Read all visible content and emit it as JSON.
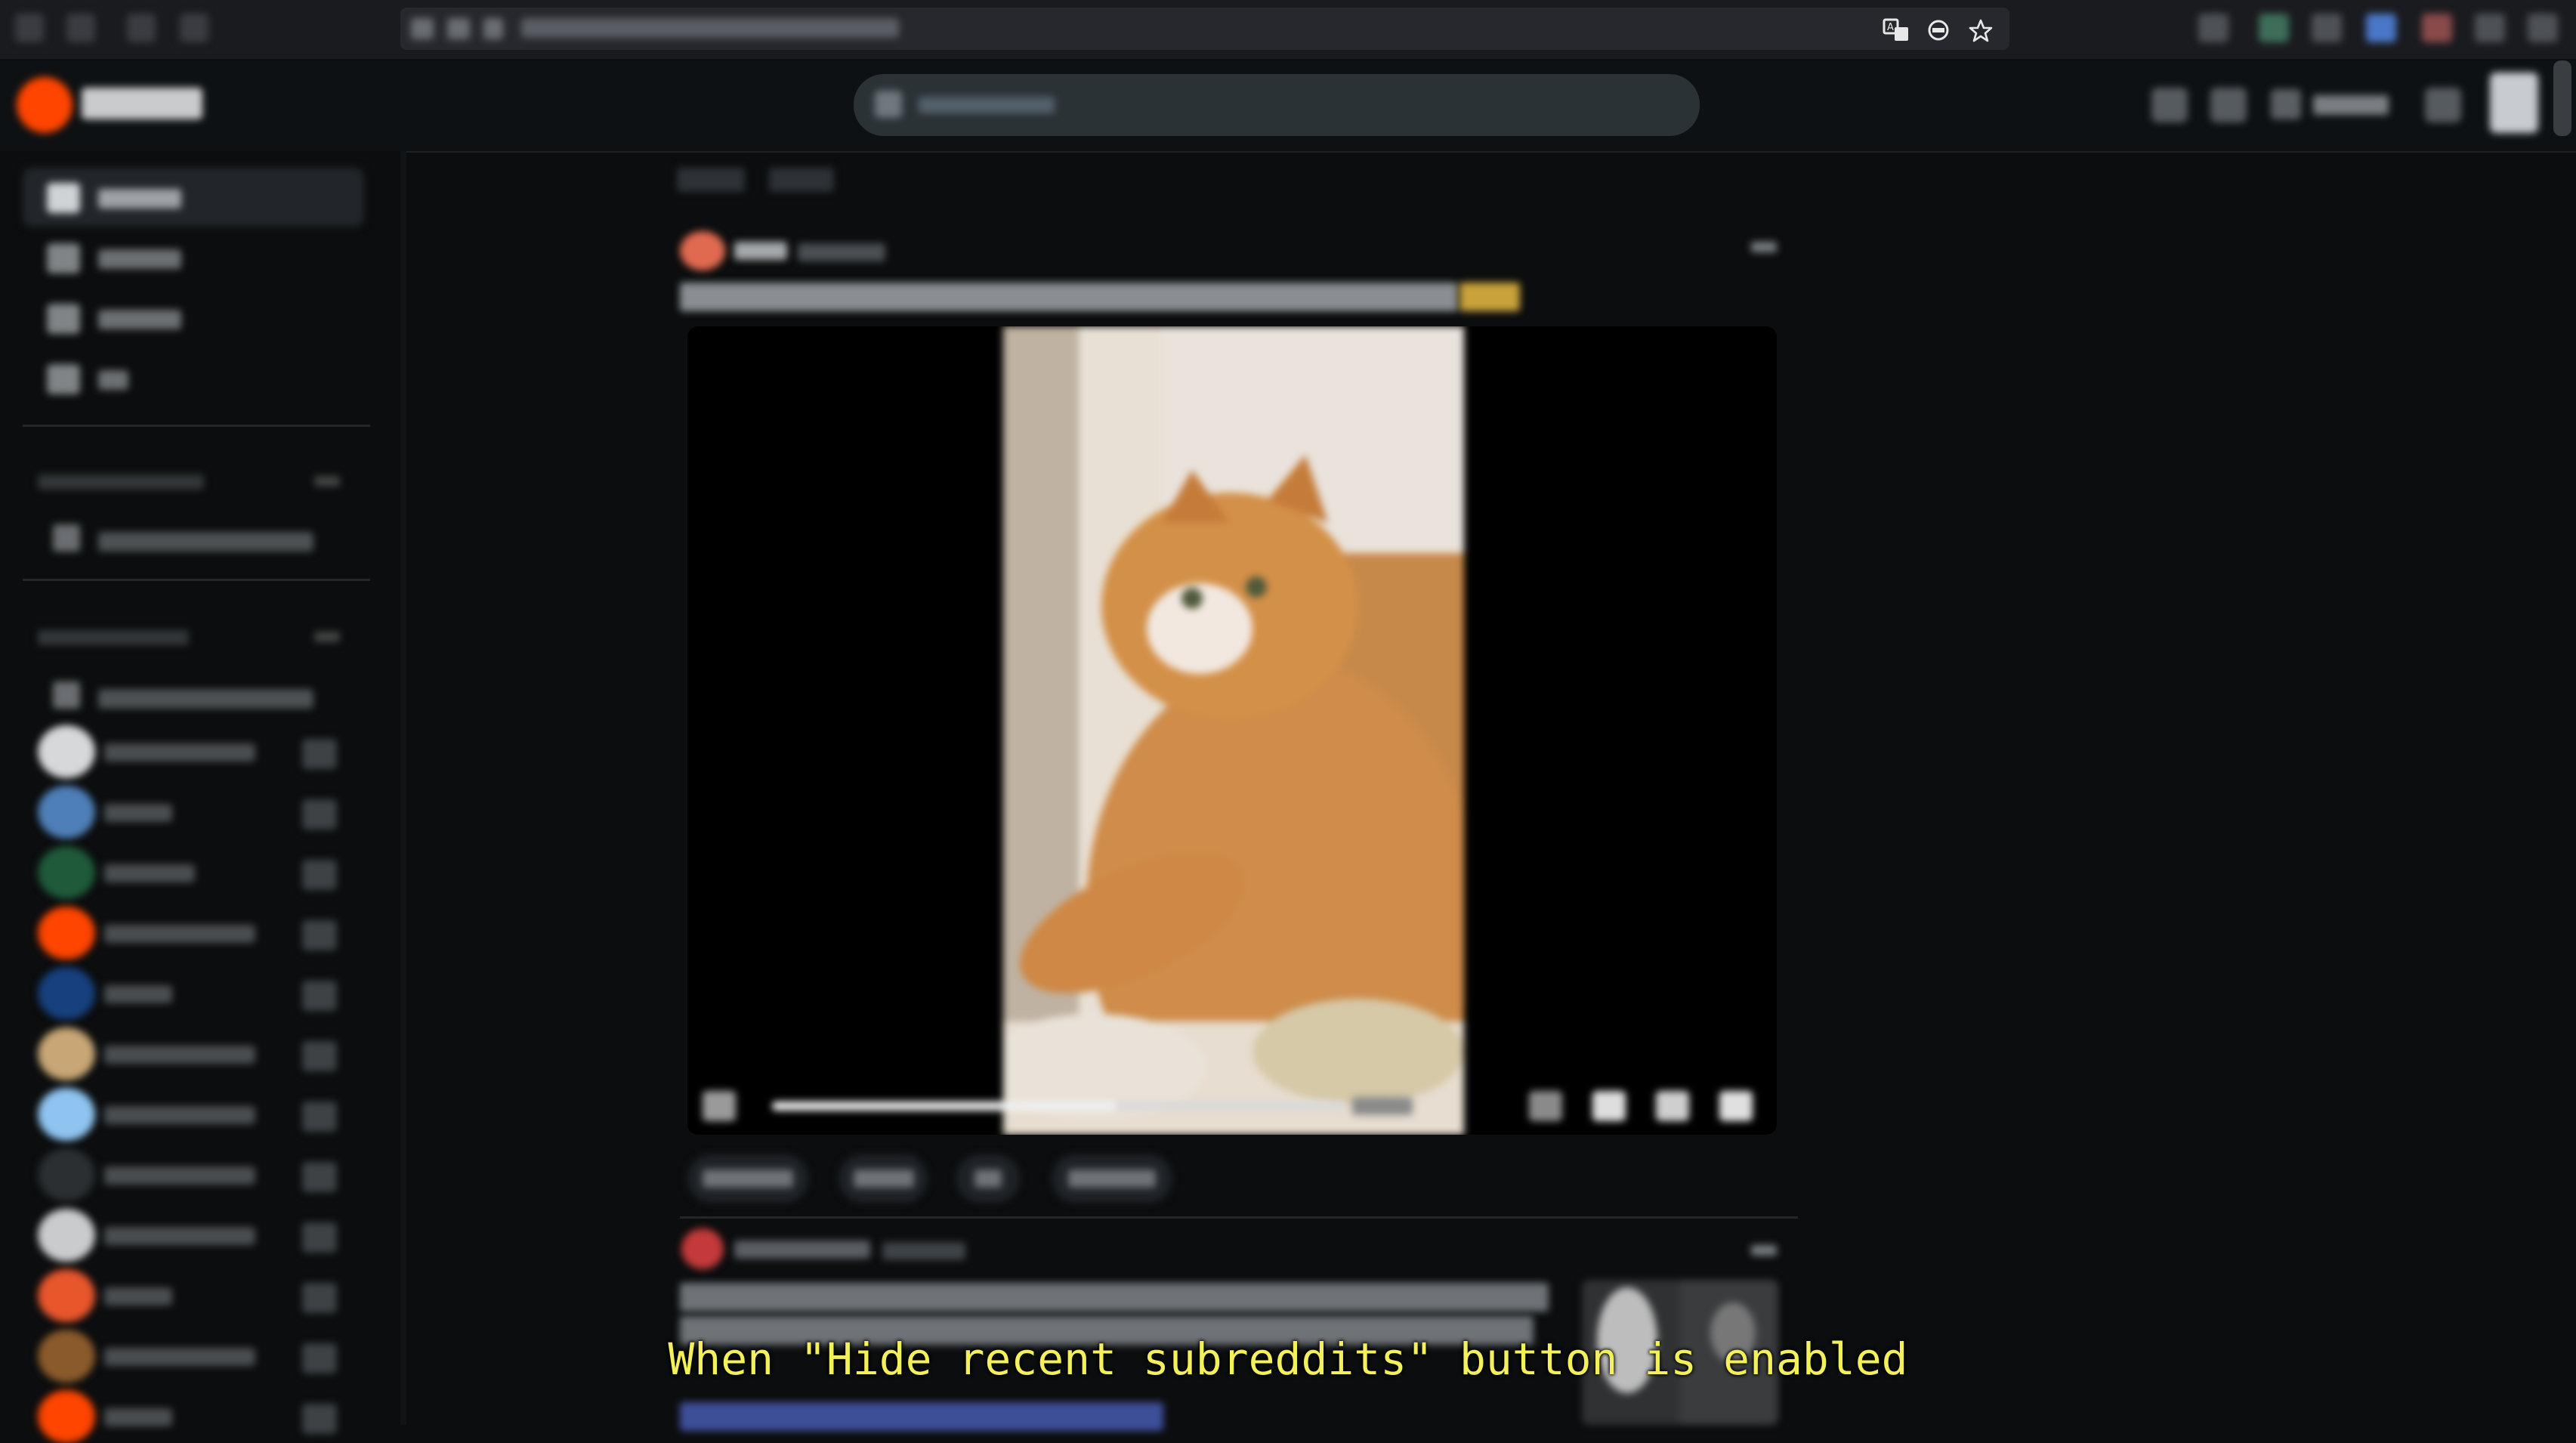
{
  "caption": "When \"Hide recent subreddits\" button is enabled",
  "browser": {
    "url_icons": [
      "translate-icon",
      "ad-block-icon",
      "bookmark-star-icon"
    ]
  },
  "header": {
    "search_placeholder": "",
    "brand_color": "#ff4500"
  },
  "sidebar": {
    "nav_items": [
      {
        "name": "home",
        "active": true
      },
      {
        "name": "popular",
        "active": false
      },
      {
        "name": "explore",
        "active": false
      },
      {
        "name": "all",
        "active": false
      }
    ],
    "communities": [
      {
        "color": "#d6d8da",
        "name_width_hint": "long"
      },
      {
        "color": "#4f7fb8",
        "name_width_hint": "short"
      },
      {
        "color": "#1f5a3a",
        "name_width_hint": "medium"
      },
      {
        "color": "#ff4500",
        "name_width_hint": "long"
      },
      {
        "color": "#17407e",
        "name_width_hint": "short"
      },
      {
        "color": "#c8a675",
        "name_width_hint": "long"
      },
      {
        "color": "#8fc4f0",
        "name_width_hint": "long"
      },
      {
        "color": "#2b2f32",
        "name_width_hint": "long"
      },
      {
        "color": "#c9cbcd",
        "name_width_hint": "long"
      },
      {
        "color": "#e8562c",
        "name_width_hint": "short"
      },
      {
        "color": "#8b5a2b",
        "name_width_hint": "long"
      },
      {
        "color": "#ff4500",
        "name_width_hint": "short"
      }
    ]
  },
  "post": {
    "video_progress": 0.6
  }
}
